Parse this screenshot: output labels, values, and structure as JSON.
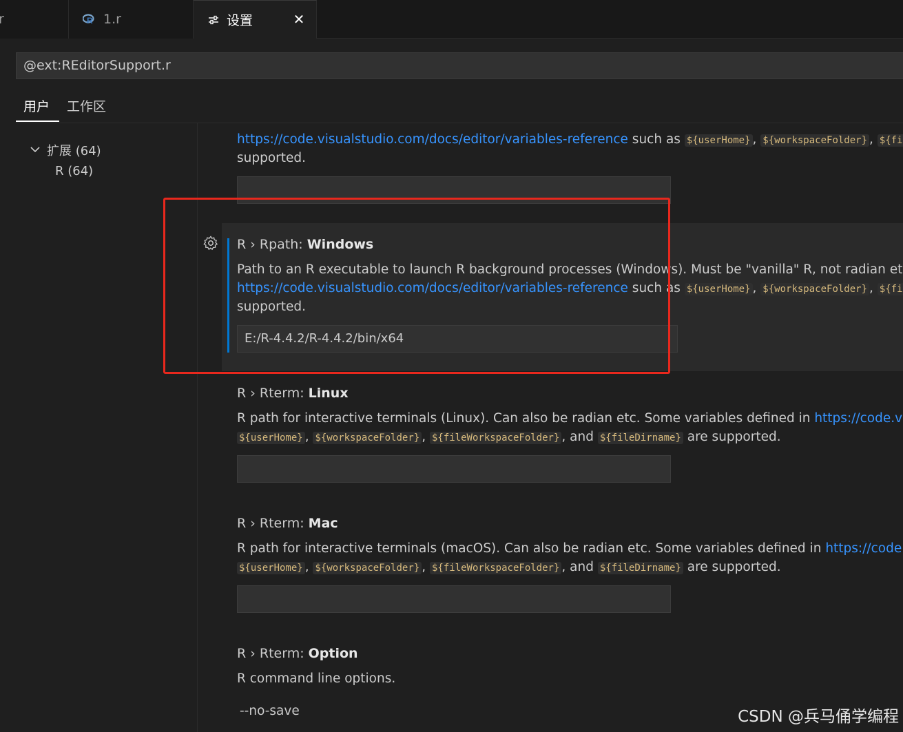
{
  "tabs": [
    {
      "label": ".r"
    },
    {
      "label": "1.r"
    },
    {
      "label": "设置",
      "close": "✕"
    }
  ],
  "search": {
    "value": "@ext:REditorSupport.r"
  },
  "scopes": {
    "user": "用户",
    "workspace": "工作区"
  },
  "toc": {
    "group": "扩展 (64)",
    "child": "R (64)"
  },
  "settings": [
    {
      "id": "top-partial",
      "link": "https://code.visualstudio.com/docs/editor/variables-reference",
      "such_as": " such as ",
      "codes": [
        "${userHome}",
        "${workspaceFolder}",
        "${fileW"
      ],
      "tail": "supported.",
      "value": ""
    },
    {
      "id": "rpath-windows",
      "prefix": "R › Rpath: ",
      "name": "Windows",
      "desc1": "Path to an R executable to launch R background processes (Windows). Must be \"vanilla\" R, not radian etc.! Some",
      "link": "https://code.visualstudio.com/docs/editor/variables-reference",
      "such_as": " such as ",
      "codes": [
        "${userHome}",
        "${workspaceFolder}",
        "${fileW"
      ],
      "tail": "supported.",
      "value": "E:/R-4.4.2/R-4.4.2/bin/x64"
    },
    {
      "id": "rterm-linux",
      "prefix": "R › Rterm: ",
      "name": "Linux",
      "desc1": "R path for interactive terminals (Linux). Can also be radian etc. Some variables defined in ",
      "link": "https://code.visualstudio.com/docs/editor/variables-reference",
      "codes": [
        "${userHome}",
        "${workspaceFolder}",
        "${fileWorkspaceFolder}",
        "${fileDirname}"
      ],
      "and": ", and ",
      "tail": " are supported.",
      "value": ""
    },
    {
      "id": "rterm-mac",
      "prefix": "R › Rterm: ",
      "name": "Mac",
      "desc1": "R path for interactive terminals (macOS). Can also be radian etc. Some variables defined in ",
      "link": "https://code.visualstudio.com/docs/editor/variables-reference",
      "codes": [
        "${userHome}",
        "${workspaceFolder}",
        "${fileWorkspaceFolder}",
        "${fileDirname}"
      ],
      "and": ", and ",
      "tail": " are supported.",
      "value": ""
    },
    {
      "id": "rterm-option",
      "prefix": "R › Rterm: ",
      "name": "Option",
      "desc1": "R command line options.",
      "list_item": "--no-save"
    }
  ],
  "watermark": "CSDN @兵马俑学编程",
  "colors": {
    "accent": "#0078d4",
    "link": "#3794ff",
    "highlight_box": "#e8281d"
  }
}
